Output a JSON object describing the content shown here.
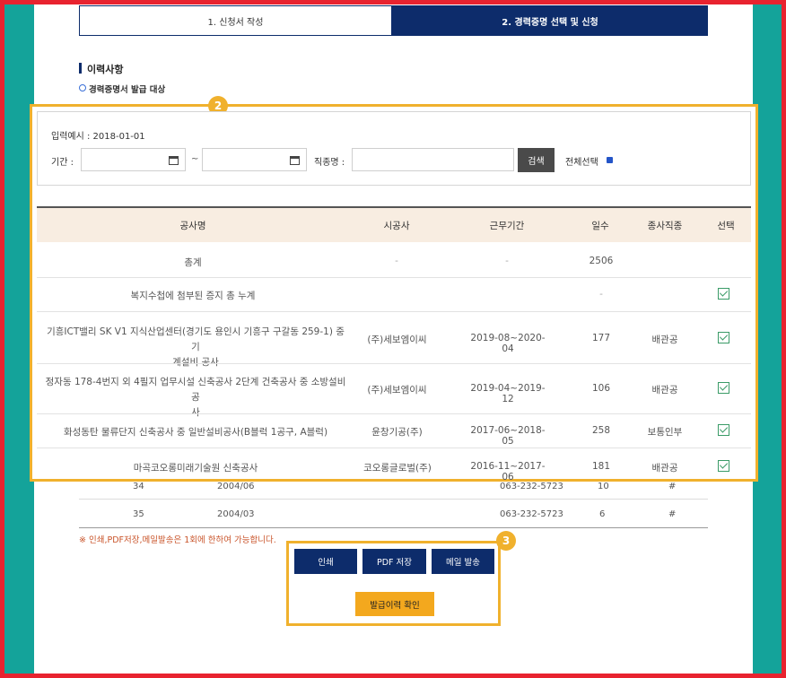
{
  "steps": {
    "step1": "1. 신청서 작성",
    "step2": "2. 경력증명 선택 및 신청"
  },
  "section": {
    "title": "이력사항",
    "subtitle": "경력증명서 발급 대상"
  },
  "badges": {
    "b2": "2",
    "b3": "3"
  },
  "filter": {
    "hint": "입력예시 : 2018-01-01",
    "period_label": "기간 :",
    "tilde": "~",
    "job_label": "직종명 :",
    "search_label": "검색",
    "select_all_label": "전체선택"
  },
  "table": {
    "headers": [
      "공사명",
      "시공사",
      "근무기간",
      "일수",
      "종사직종",
      "선택"
    ],
    "rows": [
      {
        "name": "총계",
        "company": "-",
        "period": "-",
        "days": "2506",
        "job": "",
        "selected": false
      },
      {
        "name": "복지수첩에 첨부된 증지 총 누계",
        "company": "",
        "period": "",
        "days": "-",
        "job": "",
        "selected": true
      },
      {
        "name1": "기흥ICT밸리 SK V1 지식산업센터(경기도 용인시 기흥구 구갈동 259-1) 중 기",
        "name2": "계설비 공사",
        "company": "(주)세보엠이씨",
        "period": "2019-08~2020-04",
        "days": "177",
        "job": "배관공",
        "selected": true
      },
      {
        "name1": "정자동 178-4번지 외 4필지 업무시설 신축공사 2단계 건축공사 중 소방설비공",
        "name2": "사",
        "company": "(주)세보엠이씨",
        "period": "2019-04~2019-12",
        "days": "106",
        "job": "배관공",
        "selected": true
      },
      {
        "name": "화성동탄 물류단지 신축공사 중 일반설비공사(B블럭 1공구, A블럭)",
        "company": "윤창기공(주)",
        "period": "2017-06~2018-05",
        "days": "258",
        "job": "보통인부",
        "selected": true
      },
      {
        "name": "마곡코오롱미래기술원 신축공사",
        "company": "코오롱글로벌(주)",
        "period": "2016-11~2017-06",
        "days": "181",
        "job": "배관공",
        "selected": true
      }
    ]
  },
  "old_rows": [
    {
      "no": "34",
      "date": "2004/06",
      "phone": "063-232-5723",
      "count": "10",
      "mark": "#"
    },
    {
      "no": "35",
      "date": "2004/03",
      "phone": "063-232-5723",
      "count": "6",
      "mark": "#"
    }
  ],
  "notice": "※ 인쇄,PDF저장,메일발송은 1회에 한하여 가능합니다.",
  "buttons": {
    "print": "인쇄",
    "pdf": "PDF 저장",
    "mail": "메일 발송",
    "history": "발급이력 확인"
  }
}
